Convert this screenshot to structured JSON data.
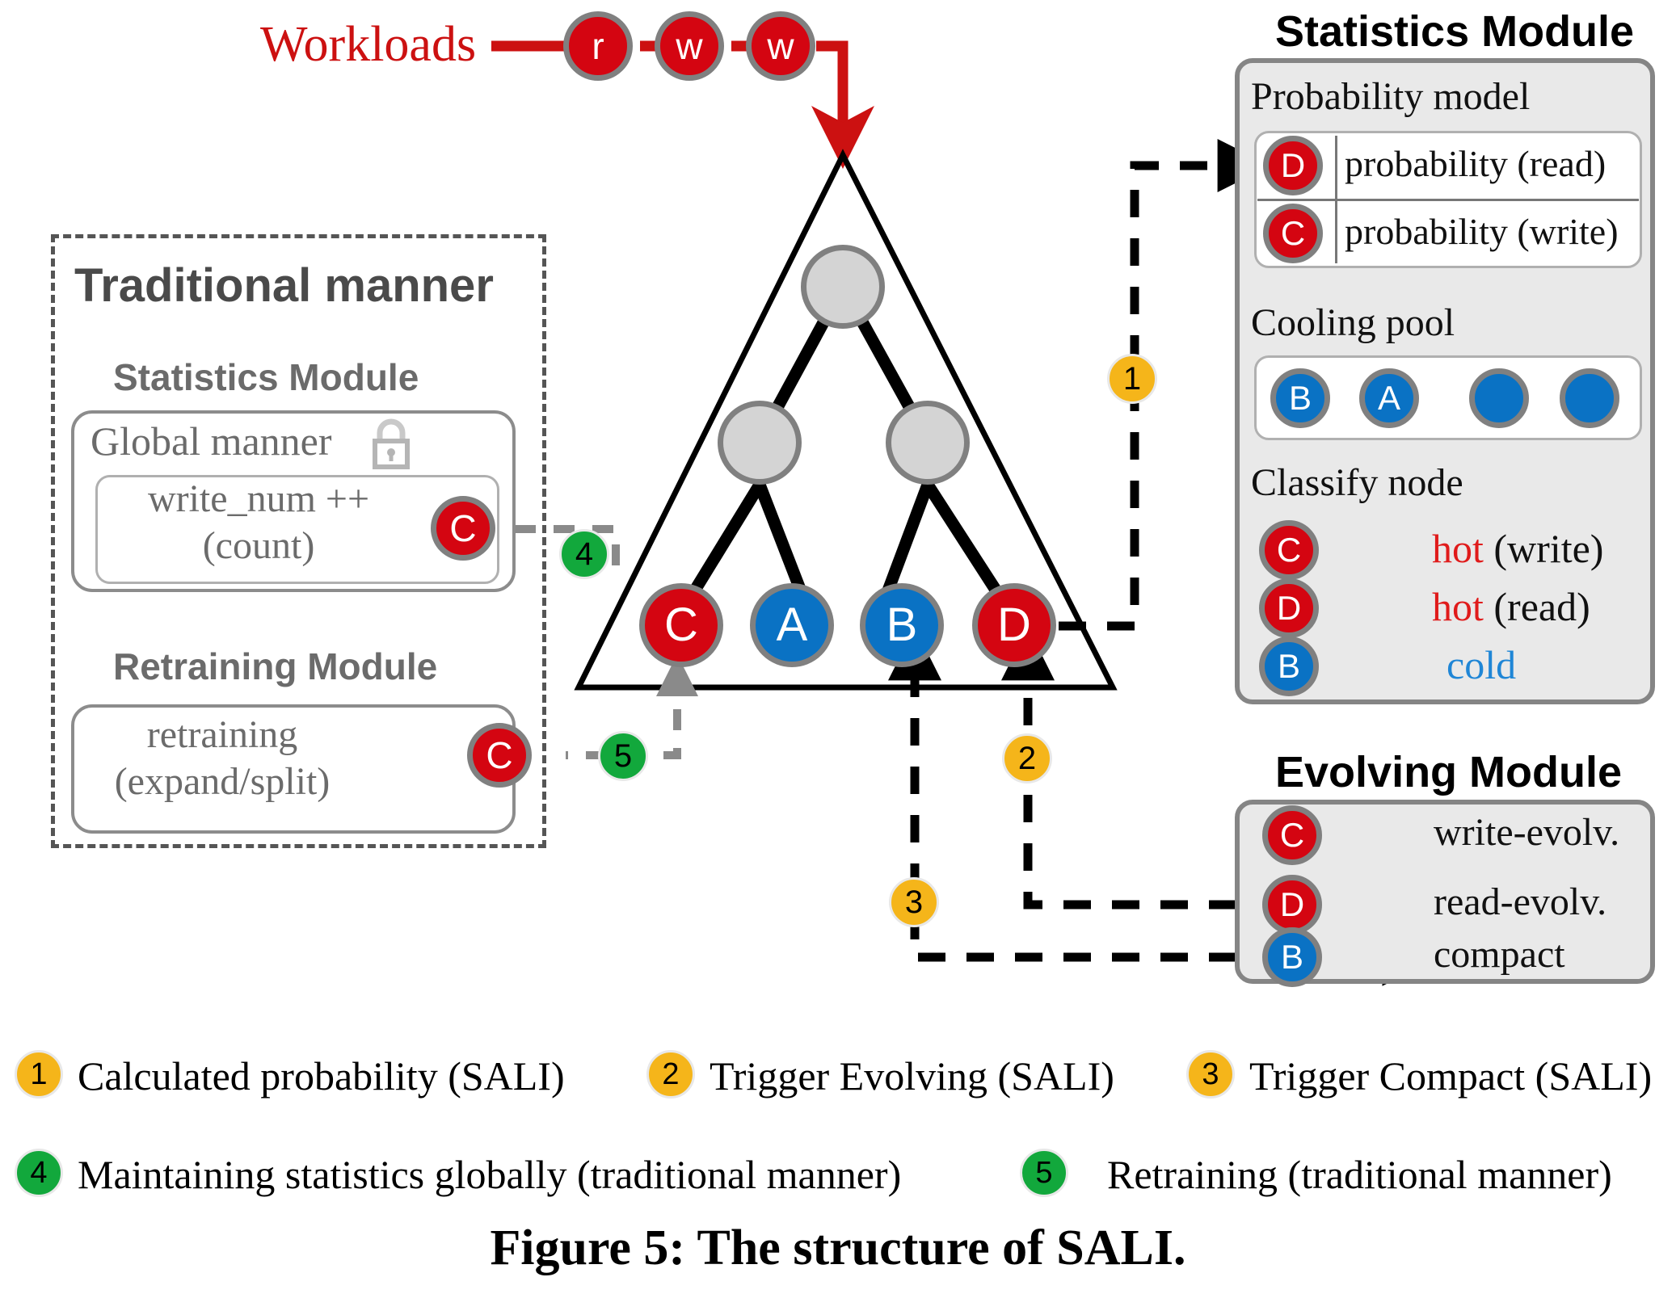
{
  "figure": {
    "caption": "Figure 5: The structure of SALI."
  },
  "workload": {
    "label": "Workloads",
    "ops": [
      "r",
      "w",
      "w"
    ]
  },
  "traditional": {
    "title": "Traditional manner",
    "statistics_title": "Statistics Module",
    "global_manner_label": "Global manner",
    "lock_icon": "lock-icon",
    "counter_line1": "write_num ++",
    "counter_line2": "(count)",
    "counter_node": "C",
    "retraining_title": "Retraining Module",
    "retraining_line1": "retraining",
    "retraining_line2": "(expand/split)",
    "retraining_node": "C"
  },
  "tree": {
    "internal_nodes": [
      "",
      "",
      ""
    ],
    "leaves": [
      {
        "label": "C",
        "kind": "hot"
      },
      {
        "label": "A",
        "kind": "cold"
      },
      {
        "label": "B",
        "kind": "cold"
      },
      {
        "label": "D",
        "kind": "hot"
      }
    ]
  },
  "statistics_module": {
    "title": "Statistics Module",
    "probability_model": {
      "heading": "Probability model",
      "rows": [
        {
          "node": "D",
          "node_kind": "hot",
          "text": "probability (read)"
        },
        {
          "node": "C",
          "node_kind": "hot",
          "text": "probability (write)"
        }
      ]
    },
    "cooling_pool": {
      "heading": "Cooling pool",
      "nodes": [
        {
          "label": "B"
        },
        {
          "label": "A"
        },
        {
          "label": ""
        },
        {
          "label": ""
        }
      ]
    },
    "classify_node": {
      "heading": "Classify node",
      "rows": [
        {
          "node": "C",
          "node_kind": "hot",
          "result": "hot",
          "suffix": " (write)",
          "result_color": "#e01b1b"
        },
        {
          "node": "D",
          "node_kind": "hot",
          "result": "hot",
          "suffix": " (read)",
          "result_color": "#e01b1b"
        },
        {
          "node": "B",
          "node_kind": "cold",
          "result": "cold",
          "suffix": "",
          "result_color": "#1f86d6"
        }
      ]
    }
  },
  "evolving_module": {
    "title": "Evolving Module",
    "rows": [
      {
        "node": "C",
        "node_kind": "hot",
        "text": "write-evolv."
      },
      {
        "node": "D",
        "node_kind": "hot",
        "text": "read-evolv."
      },
      {
        "node": "B",
        "node_kind": "cold",
        "text": "compact"
      }
    ]
  },
  "legend": [
    {
      "num": "1",
      "color": "#f5b51a",
      "text": "Calculated probability (SALI)"
    },
    {
      "num": "2",
      "color": "#f5b51a",
      "text": "Trigger Evolving (SALI)"
    },
    {
      "num": "3",
      "color": "#f5b51a",
      "text": "Trigger Compact (SALI)"
    },
    {
      "num": "4",
      "color": "#12a83c",
      "text": "Maintaining statistics globally (traditional manner)"
    },
    {
      "num": "5",
      "color": "#12a83c",
      "text": "Retraining (traditional manner)"
    }
  ],
  "step_badges": [
    {
      "num": "1",
      "color": "#f5b51a"
    },
    {
      "num": "2",
      "color": "#f5b51a"
    },
    {
      "num": "3",
      "color": "#f5b51a"
    },
    {
      "num": "4",
      "color": "#12a83c"
    },
    {
      "num": "5",
      "color": "#12a83c"
    }
  ],
  "colors": {
    "hot": "#d40511",
    "cold": "#0a72c4",
    "neutral": "#d4d4d4",
    "ring": "#808080",
    "workload_red": "#cc1111",
    "panel_bg": "#e9e9e9",
    "panel_border": "#858585",
    "traditional_grey": "#7d7d7d"
  }
}
